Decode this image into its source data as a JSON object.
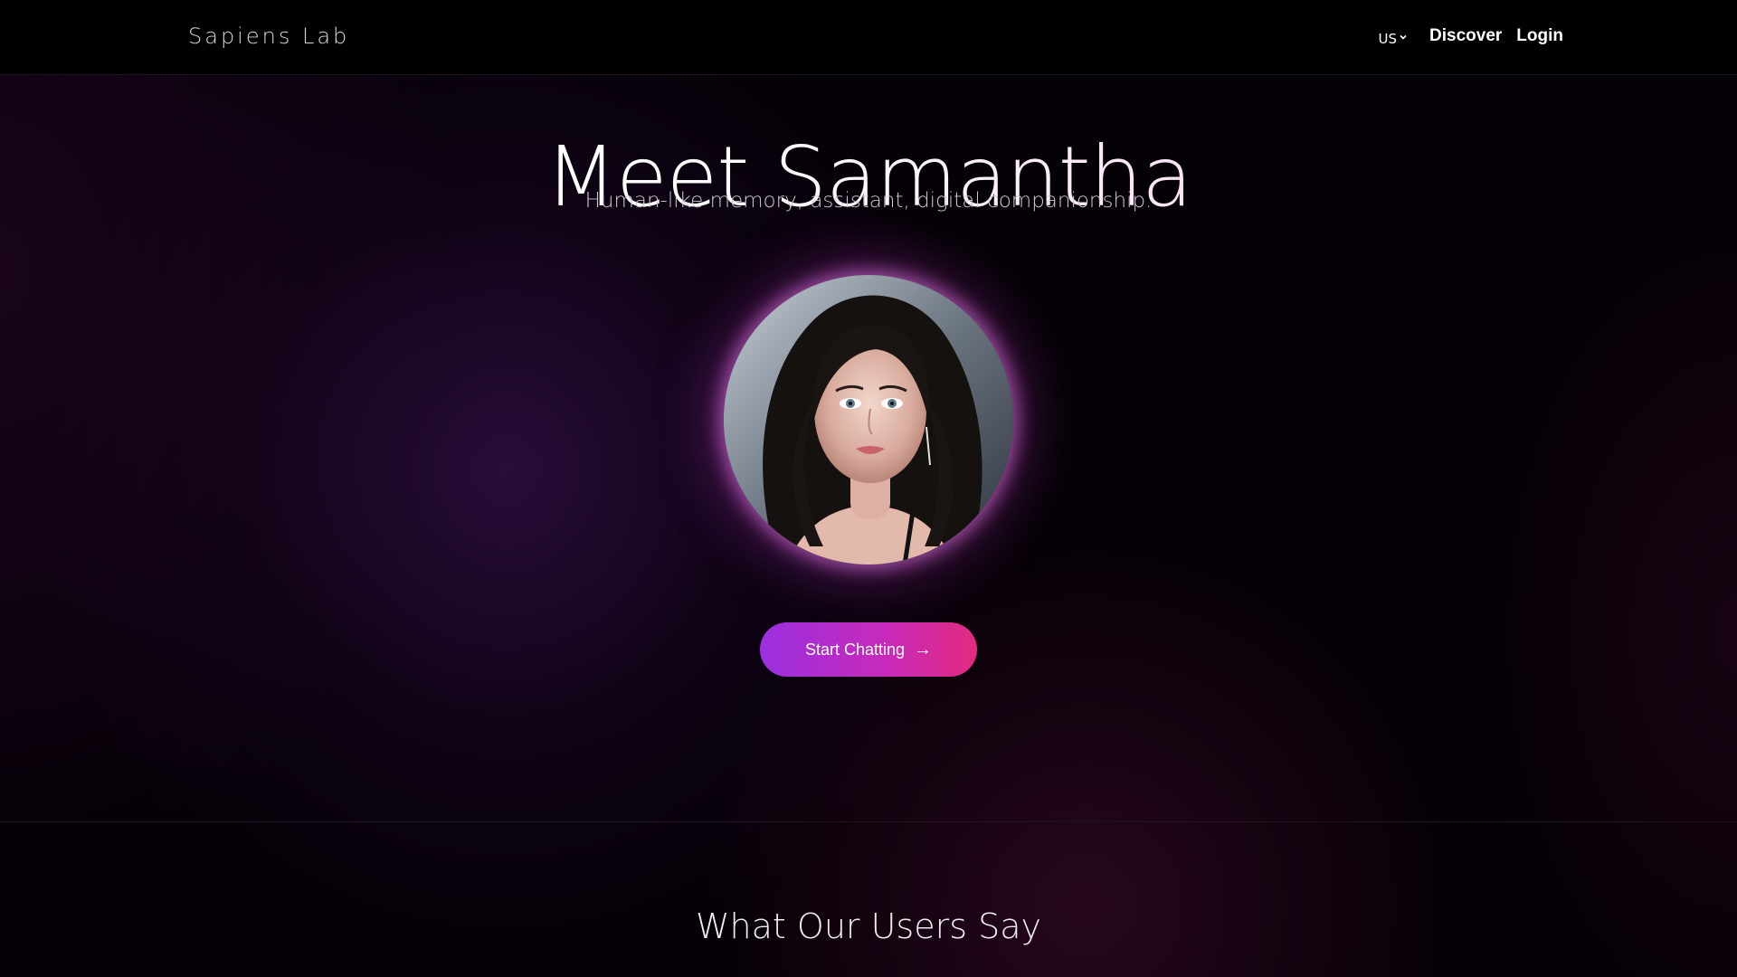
{
  "navbar": {
    "brand": "Sapiens Lab",
    "locale": "US",
    "links": [
      "Discover",
      "Login"
    ]
  },
  "hero": {
    "title": "Meet Samantha",
    "subtitle": "Human-like memory, assistant, digital companionship.",
    "cta_label": "Start Chatting",
    "cta_icon": "arrow-right-icon"
  },
  "testimonials": {
    "title": "What Our Users Say"
  },
  "colors": {
    "cta_start": "#9b2fe0",
    "cta_end": "#e22a7f",
    "glow": "#e678e6",
    "background": "#050006"
  }
}
